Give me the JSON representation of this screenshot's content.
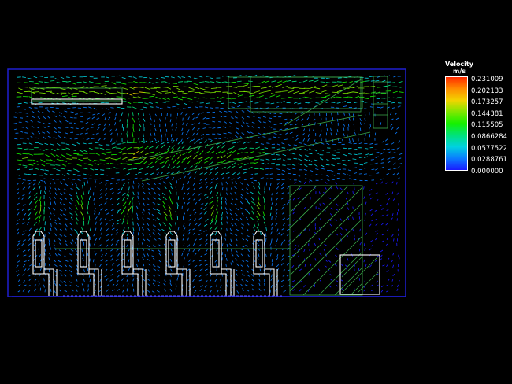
{
  "legend": {
    "title": "Velocity",
    "unit": "m/s",
    "values": [
      "0.231009",
      "0.202133",
      "0.173257",
      "0.144381",
      "0.115505",
      "0.0866284",
      "0.0577522",
      "0.0288761",
      "0.000000"
    ],
    "colors": [
      "#ff2a00",
      "#ff8c00",
      "#f2d400",
      "#7ee800",
      "#14f000",
      "#00e27a",
      "#00d2e0",
      "#0a7cff",
      "#1a1aff"
    ]
  },
  "palette": {
    "domain_outline": "#1f1fd0",
    "structure": "#ffffff",
    "grid_lines": "#3aa84a"
  }
}
